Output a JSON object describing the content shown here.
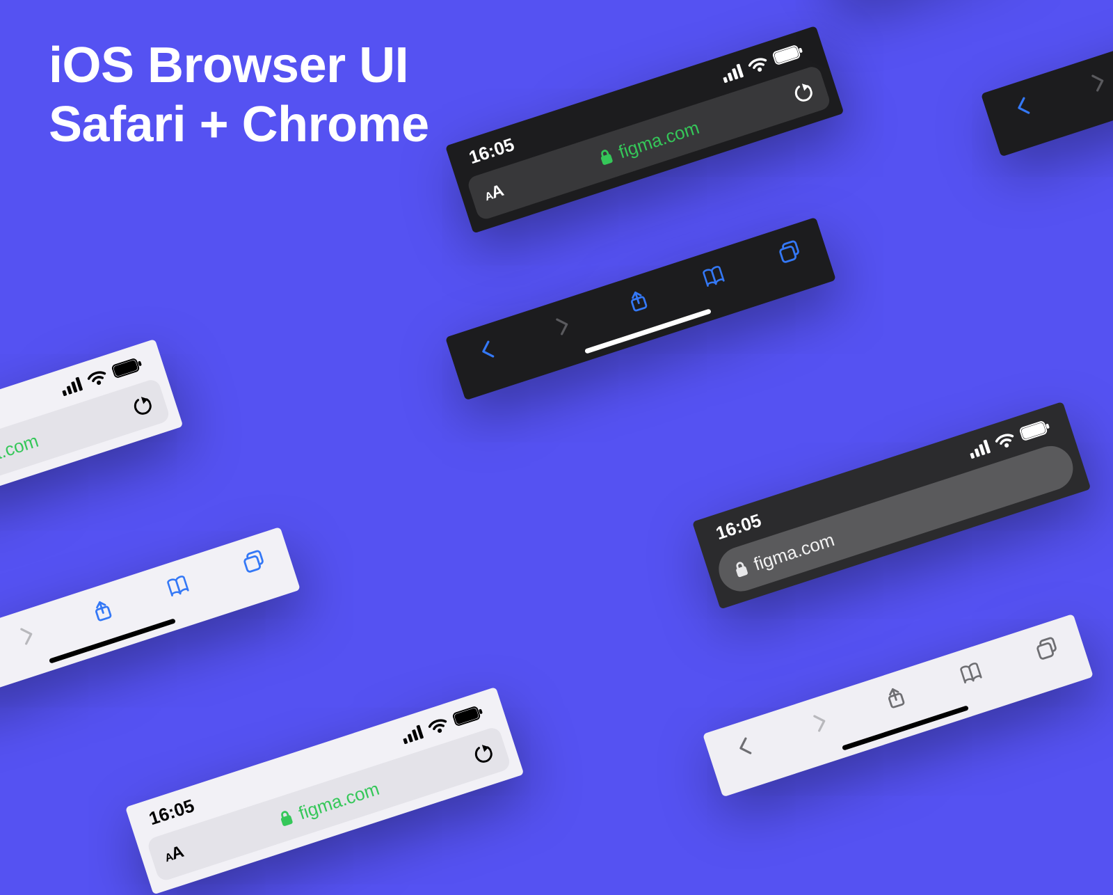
{
  "title_line1": "iOS Browser UI",
  "title_line2": "Safari + Chrome",
  "time": "16:05",
  "domain": "figma.com",
  "domain_truncated": "figma.com",
  "aa_label": "AA",
  "colors": {
    "background": "#5552F2",
    "ios_blue": "#3478f6",
    "lock_green": "#35c759",
    "light_surface": "#f2f1f6",
    "light_field": "#e4e3e9",
    "dark_surface": "#1c1c1e",
    "dark_field": "#38383a",
    "chrome_dark_surface": "#2b2b2d",
    "chrome_dark_field": "#5a5a5c"
  },
  "icons": {
    "cellular": "cellular-icon",
    "wifi": "wifi-icon",
    "battery": "battery-icon",
    "reload": "reload-icon",
    "lock": "lock-icon",
    "back": "chevron-left-icon",
    "forward": "chevron-right-icon",
    "share": "share-icon",
    "bookmarks": "book-icon",
    "tabs": "tabs-icon"
  }
}
